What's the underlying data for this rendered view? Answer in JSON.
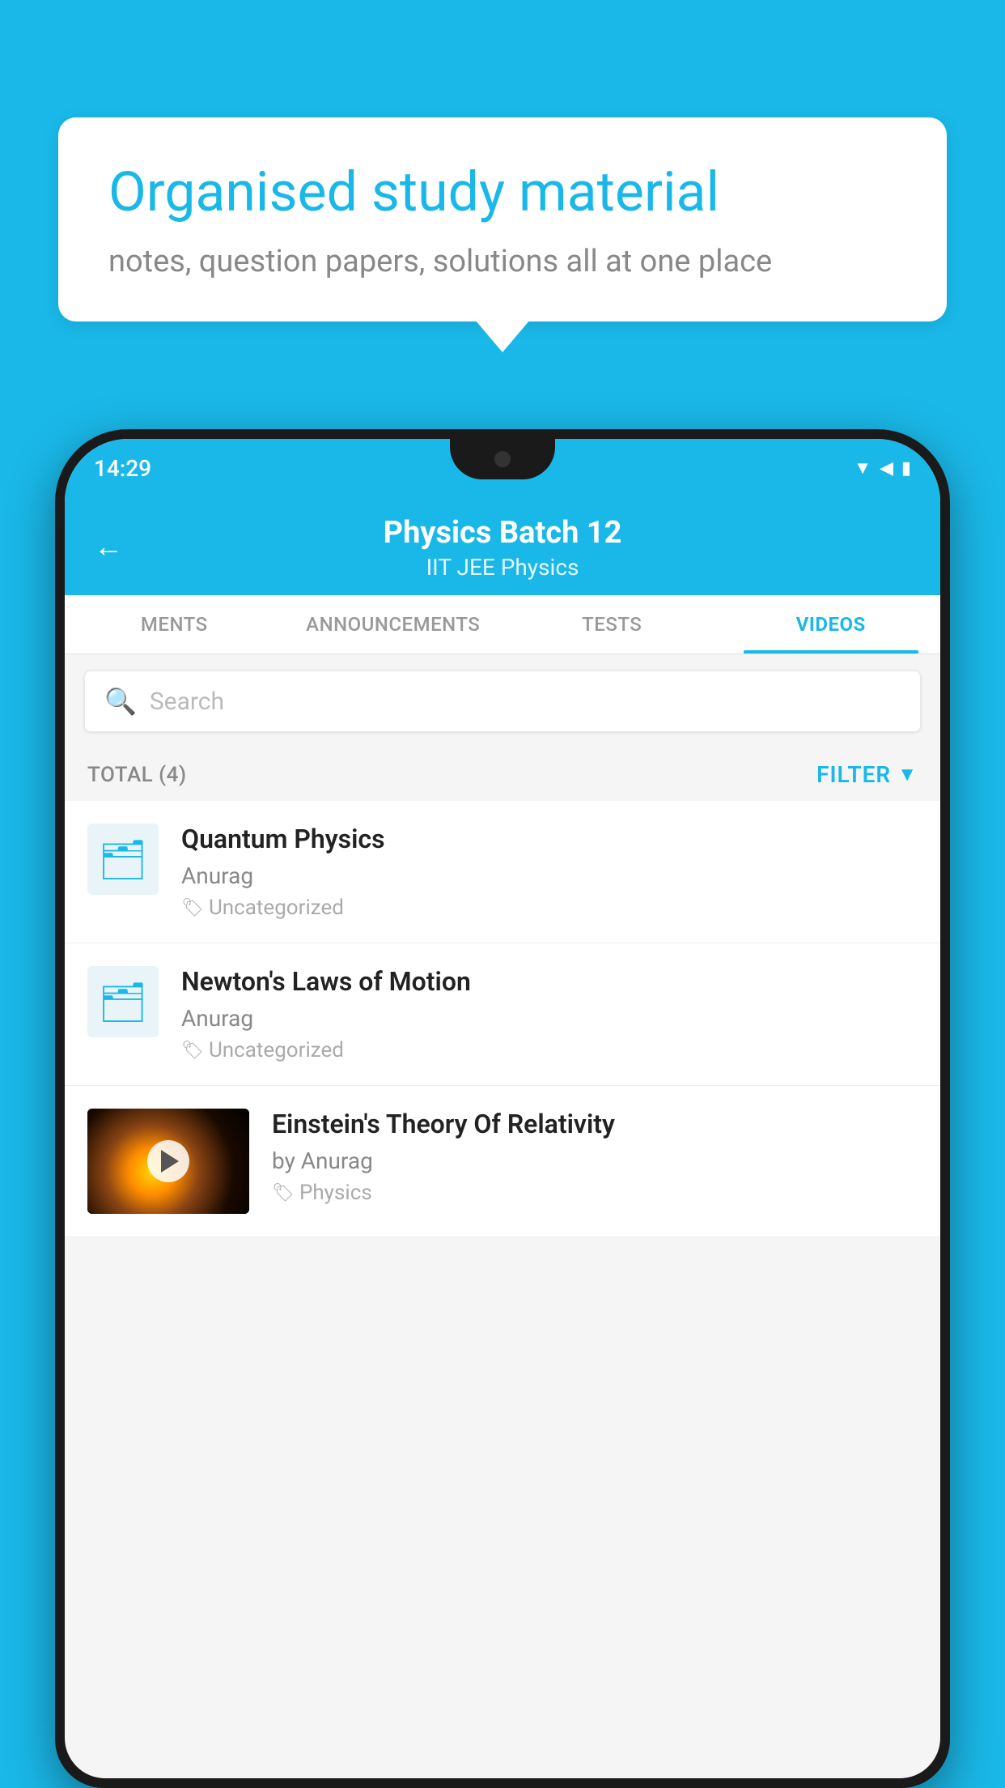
{
  "background": {
    "color": "#1ab8e8"
  },
  "speech_bubble": {
    "title": "Organised study material",
    "subtitle": "notes, question papers, solutions all at one place"
  },
  "phone": {
    "status_bar": {
      "time": "14:29",
      "icons": [
        "wifi",
        "signal",
        "battery"
      ]
    },
    "header": {
      "back_label": "←",
      "title": "Physics Batch 12",
      "subtitle": "IIT JEE   Physics"
    },
    "tabs": [
      {
        "label": "MENTS",
        "active": false
      },
      {
        "label": "ANNOUNCEMENTS",
        "active": false
      },
      {
        "label": "TESTS",
        "active": false
      },
      {
        "label": "VIDEOS",
        "active": true
      }
    ],
    "search": {
      "placeholder": "Search"
    },
    "filter_bar": {
      "total": "TOTAL (4)",
      "filter_label": "FILTER"
    },
    "videos": [
      {
        "title": "Quantum Physics",
        "author": "Anurag",
        "tag": "Uncategorized",
        "type": "folder"
      },
      {
        "title": "Newton's Laws of Motion",
        "author": "Anurag",
        "tag": "Uncategorized",
        "type": "folder"
      },
      {
        "title": "Einstein's Theory Of Relativity",
        "author": "by Anurag",
        "tag": "Physics",
        "type": "video"
      }
    ]
  }
}
